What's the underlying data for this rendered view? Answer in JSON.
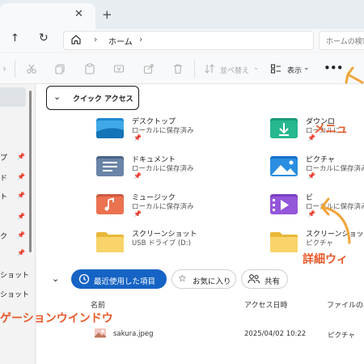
{
  "tabbar": {
    "close_glyph": "✕",
    "add_glyph": "+"
  },
  "address": {
    "up_glyph": "↑",
    "refresh_glyph": "↻",
    "home_icon": "home-icon",
    "chevron": "›",
    "crumb": "ホーム",
    "search_placeholder": "ホームの検索"
  },
  "toolbar": {
    "sort_label": "並べ替え",
    "view_label": "表示",
    "more_glyph": "•••",
    "icons": [
      "cut-icon",
      "copy-icon",
      "paste-icon",
      "rename-icon",
      "share-icon",
      "delete-icon"
    ]
  },
  "sidebar": {
    "items": [
      {
        "label": "プ",
        "pinned": true
      },
      {
        "label": "ド",
        "pinned": true
      },
      {
        "label": "ト",
        "pinned": true
      },
      {
        "label": "",
        "pinned": true
      },
      {
        "label": "ク",
        "pinned": true
      },
      {
        "label": "",
        "pinned": true
      },
      {
        "label": "ショット",
        "pinned": false
      },
      {
        "label": "ショット",
        "pinned": false
      }
    ]
  },
  "quick_access": {
    "chevron": "⌄",
    "label": "クイック アクセス",
    "items": [
      {
        "name": "デスクトップ",
        "sub": "ローカルに保存済み",
        "pinned": true,
        "icon": "desktop-folder-icon"
      },
      {
        "name": "ダウンロ",
        "sub": "ローカルに",
        "pinned": true,
        "icon": "downloads-folder-icon"
      },
      {
        "name": "ドキュメント",
        "sub": "ローカルに保存済み",
        "pinned": true,
        "icon": "documents-folder-icon"
      },
      {
        "name": "ピクチャ",
        "sub": "ローカルに保存済み",
        "pinned": true,
        "icon": "pictures-folder-icon"
      },
      {
        "name": "ミュージック",
        "sub": "ローカルに保存済み",
        "pinned": true,
        "icon": "music-folder-icon"
      },
      {
        "name": "ビ",
        "sub": "ローカルに保存済み",
        "pinned": true,
        "icon": "videos-folder-icon"
      },
      {
        "name": "スクリーンショット",
        "sub": "USB ドライブ (D:)",
        "pinned": false,
        "icon": "folder-icon"
      },
      {
        "name": "スクリーンショット",
        "sub": "ピクチャ",
        "pinned": false,
        "icon": "folder-icon"
      }
    ]
  },
  "filters": {
    "chevron": "⌄",
    "recent": "最近使用した項目",
    "favorites": "お気に入り",
    "shared": "共有"
  },
  "list": {
    "col_name": "名前",
    "col_access": "アクセス日時",
    "col_location": "ファイルの場",
    "rows": [
      {
        "name": "sakura.jpeg",
        "date": "2025/04/02 10:22",
        "location": "ピクチャ"
      }
    ]
  },
  "annotations": {
    "menu": "メニュ",
    "details": "詳細ウィ",
    "nav": "ゲーションウインドウ"
  },
  "colors": {
    "accent": "#1563c4",
    "annotation": "#e8592a"
  }
}
